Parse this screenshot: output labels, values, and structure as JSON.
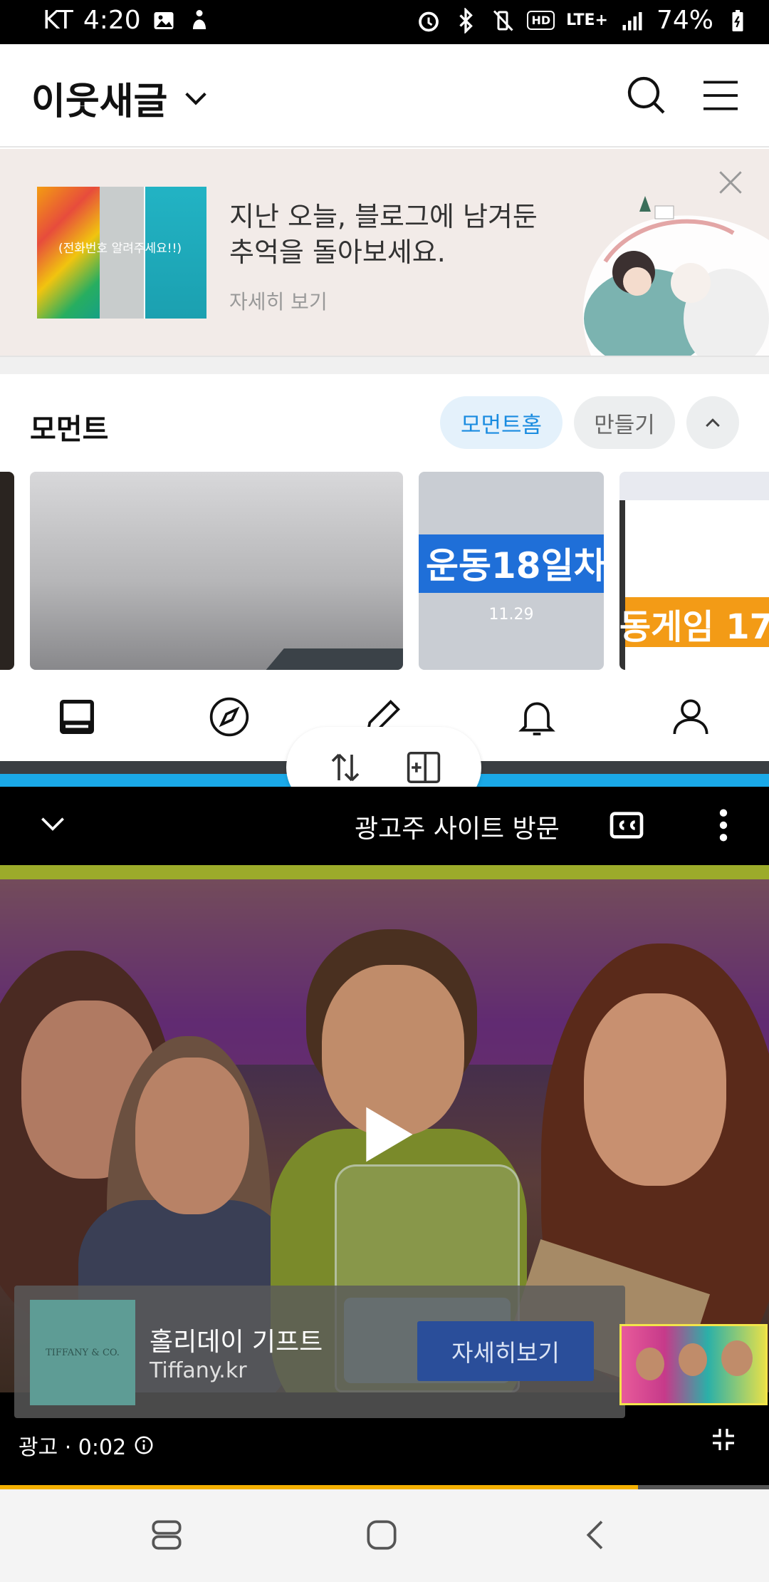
{
  "status_bar": {
    "carrier": "KT",
    "time": "4:20",
    "battery": "74%",
    "network": "LTE+",
    "hd_badge": "HD"
  },
  "header": {
    "title": "이웃새글"
  },
  "banner": {
    "line1": "지난 오늘, 블로그에 남겨둔",
    "line2": "추억을 돌아보세요.",
    "link": "자세히 보기",
    "thumb_caption": "(전화번호 알려주세요!!)"
  },
  "moment": {
    "title": "모먼트",
    "home_label": "모먼트홈",
    "make_label": "만들기",
    "cards": [
      {
        "label": "운동18일차",
        "date": "11.29"
      },
      {
        "label": "동게임 17"
      }
    ]
  },
  "player": {
    "top_title": "광고주 사이트 방문",
    "ad": {
      "title": "홀리데이 기프트",
      "domain": "Tiffany.kr",
      "cta": "자세히보기",
      "logo_text": "TIFFANY & CO."
    },
    "status": "광고 · 0:02",
    "progress": 0.83
  },
  "colors": {
    "accent_blue": "#1a8ce0",
    "split_accent": "#1aa9e8",
    "progress": "#f4b000",
    "cta": "#2a4e9a"
  }
}
